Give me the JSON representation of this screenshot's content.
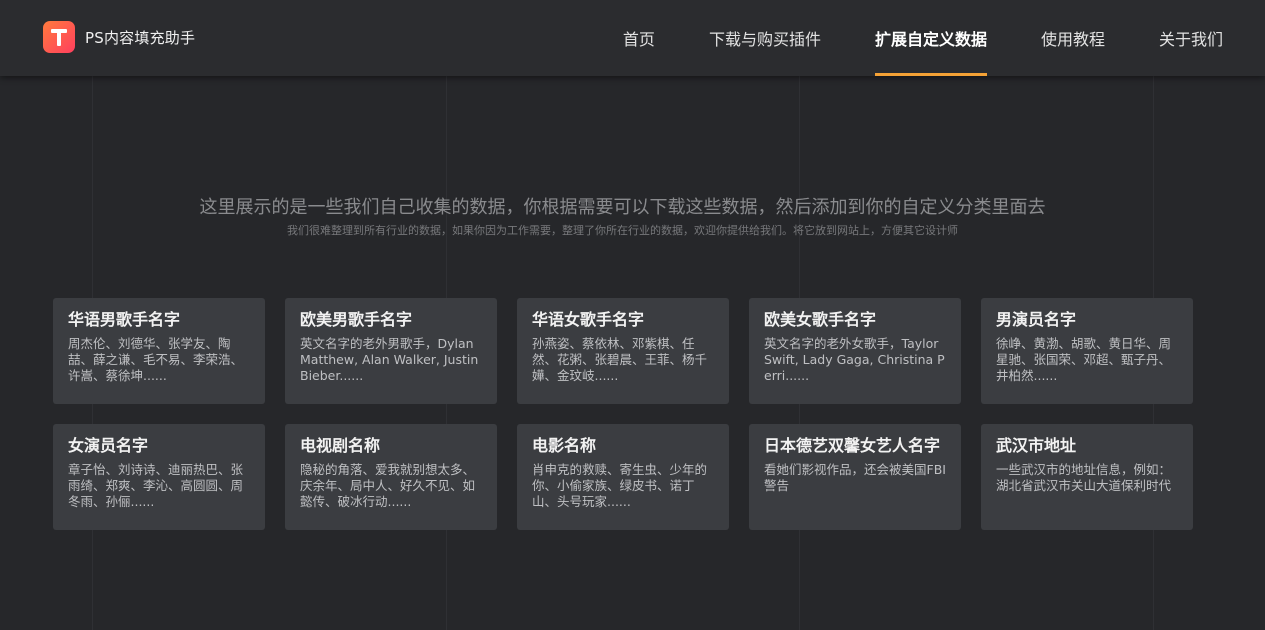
{
  "brand": {
    "logo_letter": "T",
    "name": "PS内容填充助手"
  },
  "nav": [
    {
      "label": "首页",
      "active": false
    },
    {
      "label": "下载与购买插件",
      "active": false
    },
    {
      "label": "扩展自定义数据",
      "active": true
    },
    {
      "label": "使用教程",
      "active": false
    },
    {
      "label": "关于我们",
      "active": false
    }
  ],
  "intro": {
    "title": "这里展示的是一些我们自己收集的数据，你根据需要可以下载这些数据，然后添加到你的自定义分类里面去",
    "subtitle": "我们很难整理到所有行业的数据，如果你因为工作需要，整理了你所在行业的数据，欢迎你提供给我们。将它放到网站上，方便其它设计师"
  },
  "cards": [
    {
      "title": "华语男歌手名字",
      "desc": "周杰伦、刘德华、张学友、陶喆、薛之谦、毛不易、李荣浩、许嵩、蔡徐坤......"
    },
    {
      "title": "欧美男歌手名字",
      "desc": "英文名字的老外男歌手，Dylan Matthew, Alan Walker, Justin Bieber......"
    },
    {
      "title": "华语女歌手名字",
      "desc": "孙燕姿、蔡依林、邓紫棋、任然、花粥、张碧晨、王菲、杨千嬅、金玟岐......"
    },
    {
      "title": "欧美女歌手名字",
      "desc": "英文名字的老外女歌手，Taylor Swift, Lady Gaga, Christina Perri......"
    },
    {
      "title": "男演员名字",
      "desc": "徐峥、黄渤、胡歌、黄日华、周星驰、张国荣、邓超、甄子丹、井柏然......"
    },
    {
      "title": "女演员名字",
      "desc": "章子怡、刘诗诗、迪丽热巴、张雨绮、郑爽、李沁、高圆圆、周冬雨、孙俪......"
    },
    {
      "title": "电视剧名称",
      "desc": "隐秘的角落、爱我就别想太多、庆余年、局中人、好久不见、如懿传、破冰行动......"
    },
    {
      "title": "电影名称",
      "desc": "肖申克的救赎、寄生虫、少年的你、小偷家族、绿皮书、诺丁山、头号玩家......"
    },
    {
      "title": "日本德艺双馨女艺人名字",
      "desc": "看她们影视作品，还会被美国FBI警告"
    },
    {
      "title": "武汉市地址",
      "desc": "一些武汉市的地址信息，例如：湖北省武汉市关山大道保利时代"
    }
  ]
}
